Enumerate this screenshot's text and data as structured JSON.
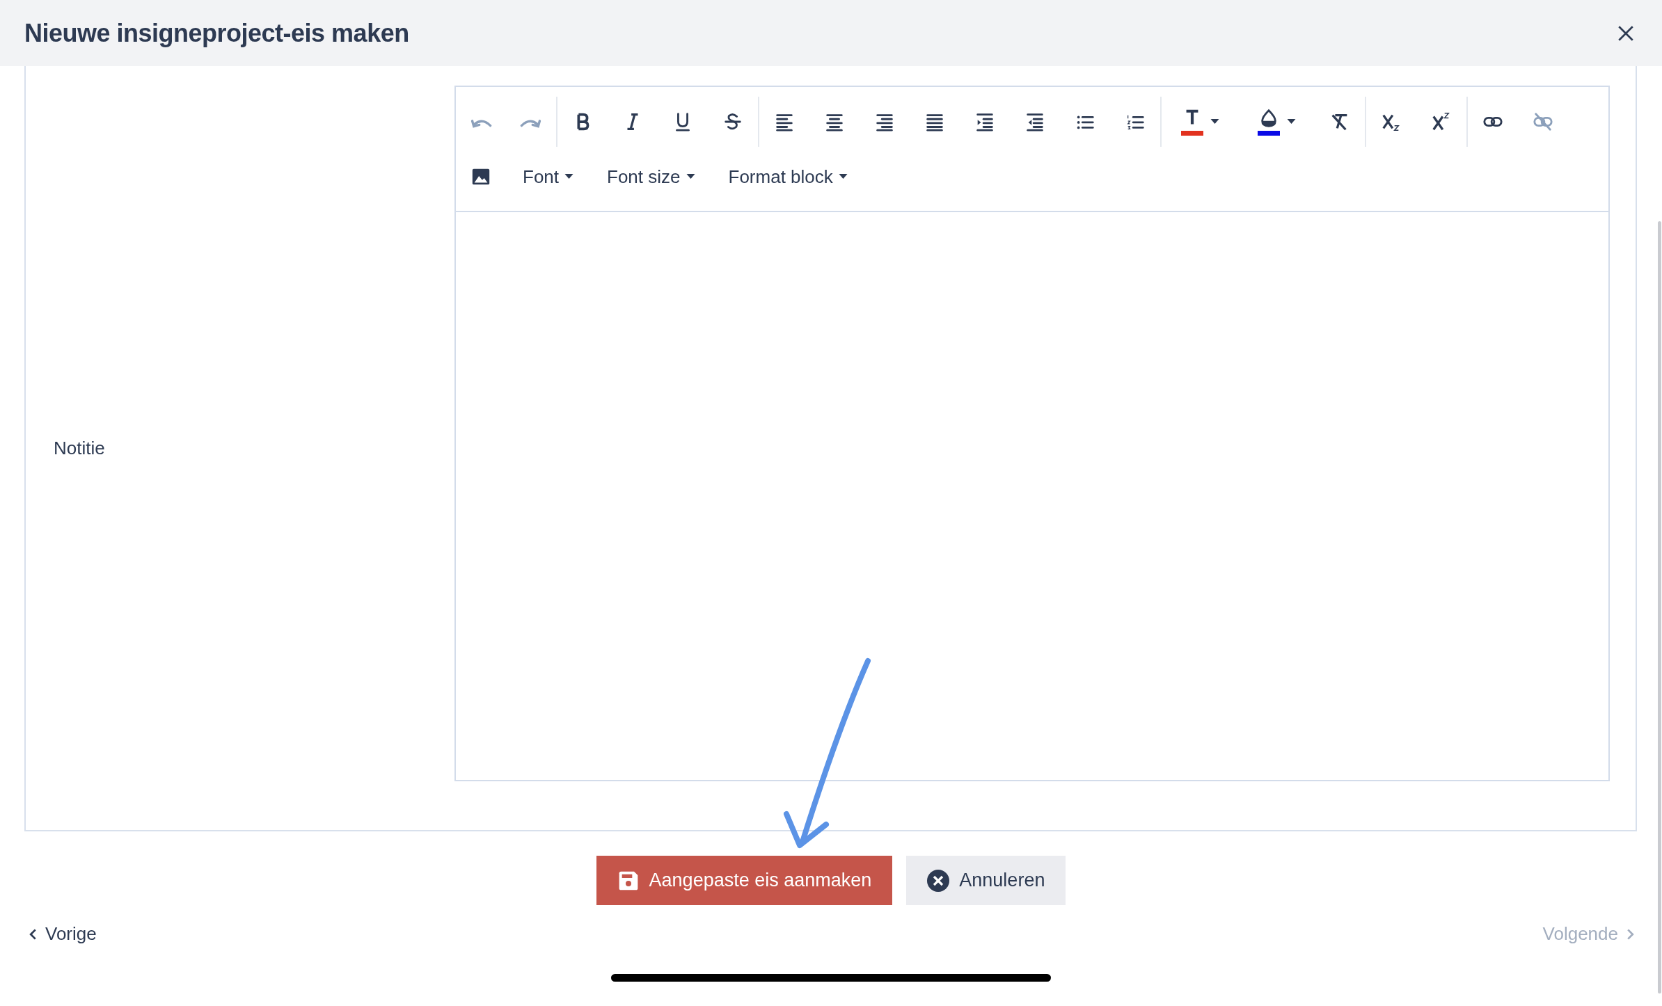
{
  "dialog": {
    "title": "Nieuwe insigneproject-eis maken"
  },
  "form": {
    "field_label": "Notitie",
    "toolbar": {
      "groups": [
        [
          {
            "kind": "undo",
            "disabled": true
          },
          {
            "kind": "redo",
            "disabled": true
          }
        ],
        [
          {
            "kind": "bold",
            "disabled": false
          },
          {
            "kind": "italic",
            "disabled": false
          },
          {
            "kind": "underline",
            "disabled": false
          },
          {
            "kind": "strikethrough",
            "disabled": false
          }
        ],
        [
          {
            "kind": "align-left",
            "disabled": false
          },
          {
            "kind": "align-center",
            "disabled": false
          },
          {
            "kind": "align-right",
            "disabled": false
          },
          {
            "kind": "justify",
            "disabled": false
          },
          {
            "kind": "indent",
            "disabled": false
          },
          {
            "kind": "outdent",
            "disabled": false
          },
          {
            "kind": "bullet-list",
            "disabled": false
          },
          {
            "kind": "numbered-list",
            "disabled": false
          }
        ],
        [
          {
            "kind": "text-color",
            "disabled": false,
            "color": "#e2321f"
          },
          {
            "kind": "highlight-color",
            "disabled": false,
            "color": "#0a0ae6"
          },
          {
            "kind": "clear-format",
            "disabled": false
          }
        ],
        [
          {
            "kind": "subscript",
            "disabled": false
          },
          {
            "kind": "superscript",
            "disabled": false
          }
        ],
        [
          {
            "kind": "link",
            "disabled": false
          },
          {
            "kind": "unlink",
            "disabled": true
          }
        ]
      ],
      "second_row": [
        {
          "kind": "image"
        },
        {
          "kind": "dropdown",
          "label": "Font"
        },
        {
          "kind": "dropdown",
          "label": "Font size"
        },
        {
          "kind": "dropdown",
          "label": "Format block"
        }
      ]
    }
  },
  "buttons": [
    {
      "kind": "save",
      "label": "Aangepaste eis aanmaken"
    },
    {
      "kind": "cancel",
      "label": "Annuleren"
    }
  ],
  "pager": [
    {
      "kind": "prev",
      "label": "Vorige",
      "disabled": false
    },
    {
      "kind": "next",
      "label": "Volgende",
      "disabled": true
    }
  ]
}
